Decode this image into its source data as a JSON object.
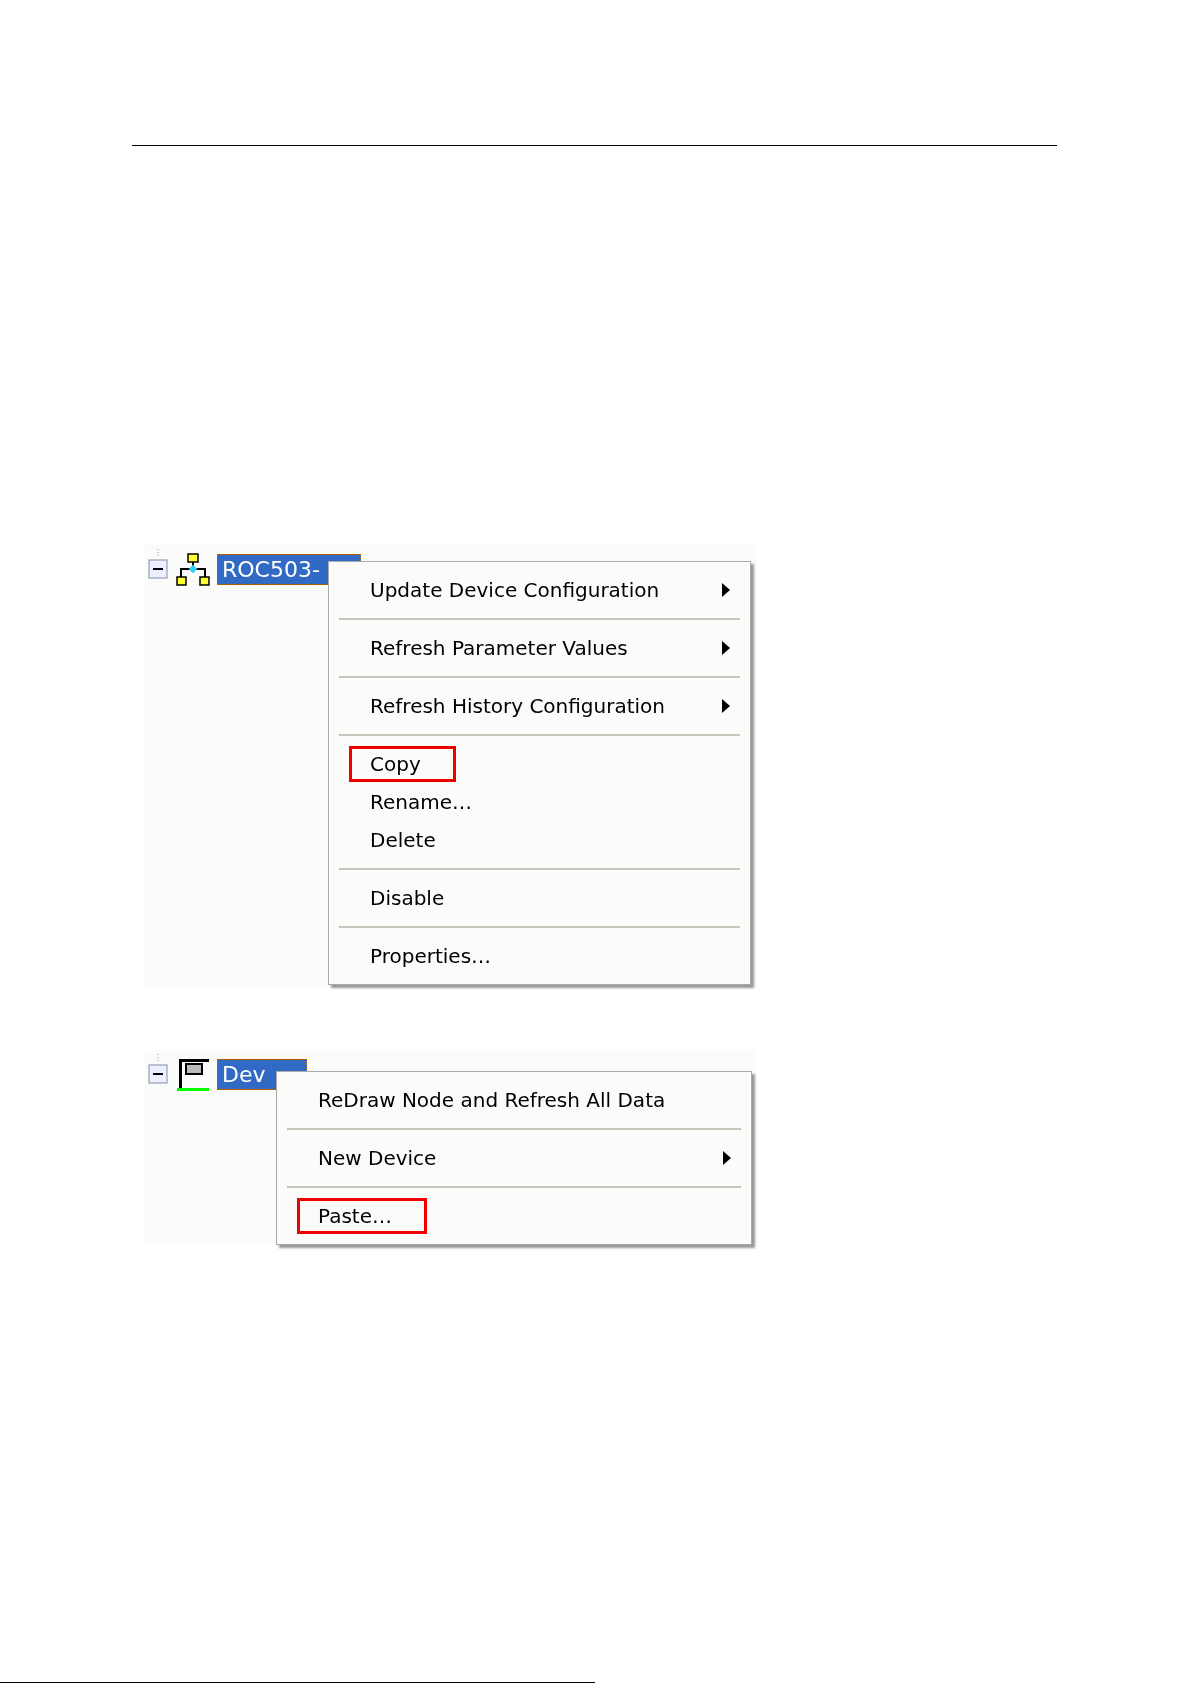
{
  "figures": [
    {
      "node": {
        "label": "ROC503-",
        "kind": "network",
        "selected": true,
        "expanded": true
      },
      "menu": {
        "kind": "wide",
        "groups": [
          [
            {
              "label": "Update Device Configuration",
              "submenu": true,
              "highlighted": false
            }
          ],
          [
            {
              "label": "Refresh Parameter Values",
              "submenu": true,
              "highlighted": false
            }
          ],
          [
            {
              "label": "Refresh History Configuration",
              "submenu": true,
              "highlighted": false
            }
          ],
          [
            {
              "label": "Copy",
              "submenu": false,
              "highlighted": true
            },
            {
              "label": "Rename…",
              "submenu": false,
              "highlighted": false
            },
            {
              "label": "Delete",
              "submenu": false,
              "highlighted": false
            }
          ],
          [
            {
              "label": "Disable",
              "submenu": false,
              "highlighted": false
            }
          ],
          [
            {
              "label": "Properties…",
              "submenu": false,
              "highlighted": false
            }
          ]
        ]
      }
    },
    {
      "node": {
        "label": "Dev",
        "kind": "device",
        "selected": true,
        "expanded": true
      },
      "menu": {
        "kind": "narrow",
        "groups": [
          [
            {
              "label": "ReDraw Node and Refresh All Data",
              "submenu": false,
              "highlighted": false
            }
          ],
          [
            {
              "label": "New Device",
              "submenu": true,
              "highlighted": false
            }
          ],
          [
            {
              "label": "Paste…",
              "submenu": false,
              "highlighted": true
            }
          ]
        ]
      }
    }
  ]
}
